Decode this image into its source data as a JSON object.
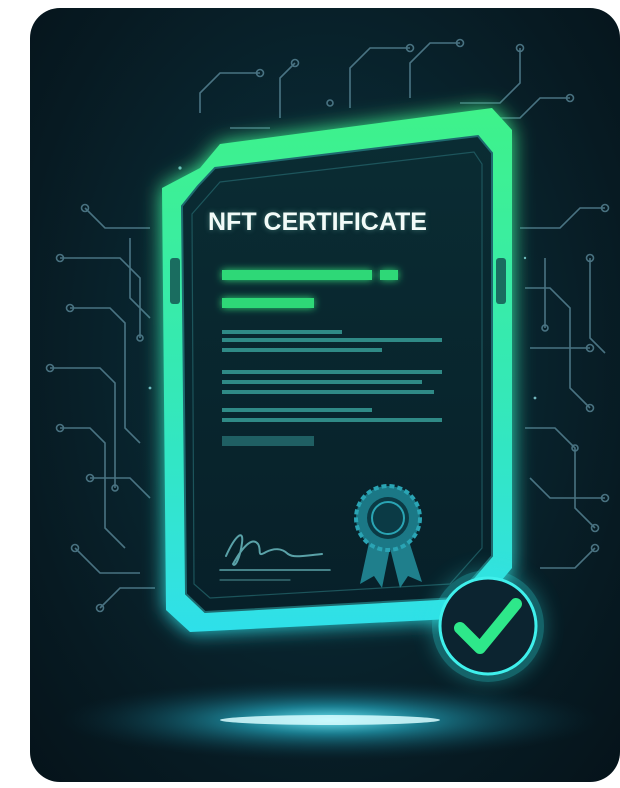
{
  "certificate": {
    "title": "NFT CERTIFICATE"
  },
  "icons": {
    "seal": "rosette-seal-icon",
    "check": "checkmark-icon",
    "signature": "signature-icon"
  },
  "colors": {
    "background": "#071a22",
    "frame_glow_top": "#3ff28a",
    "frame_glow_bottom": "#2fe8e0",
    "accent_green": "#2fd877",
    "circuit": "#5f8fa0"
  }
}
